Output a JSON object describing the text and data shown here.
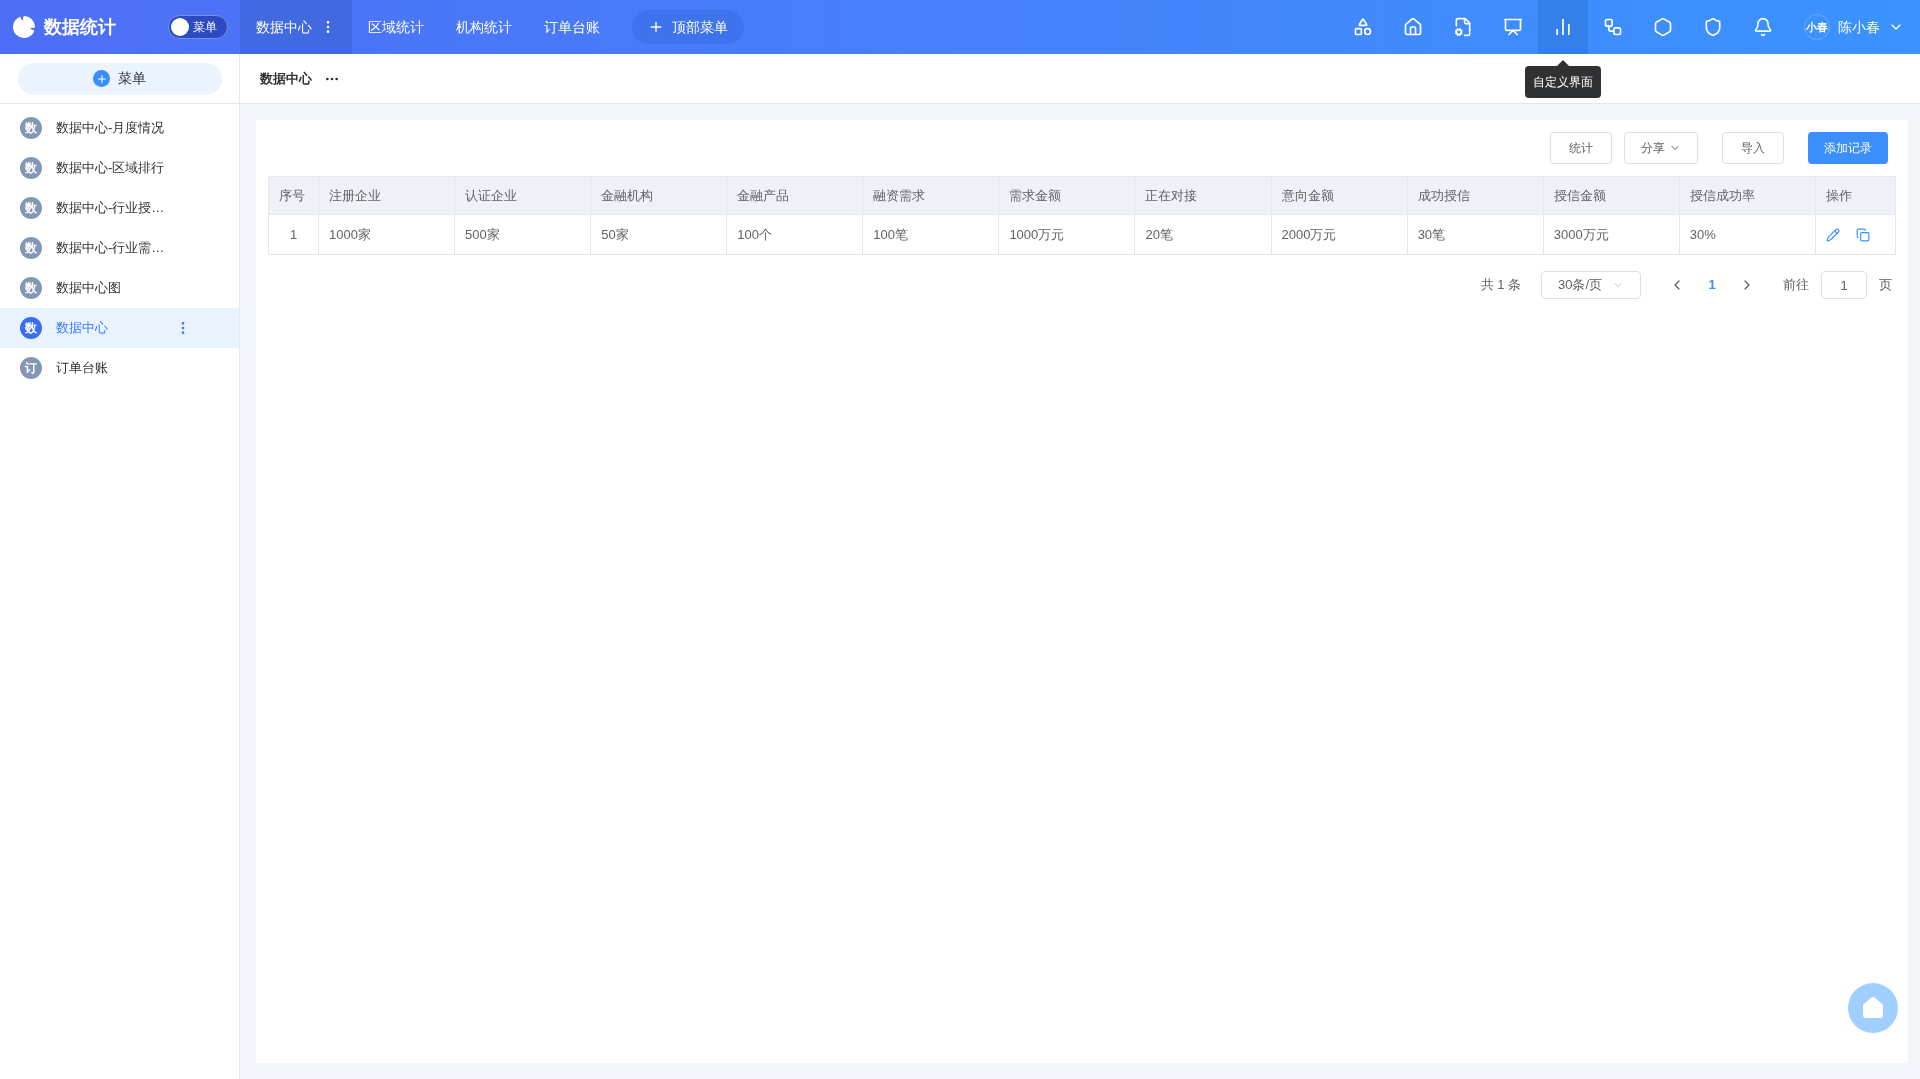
{
  "brand": {
    "title": "数据统计"
  },
  "menu_toggle": {
    "label": "菜单",
    "on": false
  },
  "top_tabs": [
    {
      "label": "数据中心",
      "selected": true,
      "has_more": true
    },
    {
      "label": "区域统计",
      "selected": false,
      "has_more": false
    },
    {
      "label": "机构统计",
      "selected": false,
      "has_more": false
    },
    {
      "label": "订单台账",
      "selected": false,
      "has_more": false
    }
  ],
  "top_menu_button": {
    "label": "顶部菜单"
  },
  "toolbar_icons": [
    {
      "kind": "shapes",
      "selected": false
    },
    {
      "kind": "home",
      "selected": false
    },
    {
      "kind": "file-gear",
      "selected": false
    },
    {
      "kind": "presentation",
      "selected": false
    },
    {
      "kind": "bars",
      "selected": true
    },
    {
      "kind": "workflow",
      "selected": false
    },
    {
      "kind": "hexagon",
      "selected": false
    },
    {
      "kind": "shield",
      "selected": false
    },
    {
      "kind": "bell",
      "selected": false
    }
  ],
  "tooltip": {
    "text": "自定义界面"
  },
  "user": {
    "avatar": "小春",
    "name": "陈小春"
  },
  "sidebar": {
    "add_button": "菜单",
    "items": [
      {
        "badge": "数",
        "label": "数据中心-月度情况",
        "selected": false
      },
      {
        "badge": "数",
        "label": "数据中心-区域排行",
        "selected": false
      },
      {
        "badge": "数",
        "label": "数据中心-行业授…",
        "selected": false
      },
      {
        "badge": "数",
        "label": "数据中心-行业需…",
        "selected": false
      },
      {
        "badge": "数",
        "label": "数据中心图",
        "selected": false
      },
      {
        "badge": "数",
        "label": "数据中心",
        "selected": true
      },
      {
        "badge": "订",
        "label": "订单台账",
        "selected": false
      }
    ]
  },
  "breadcrumb": {
    "title": "数据中心"
  },
  "actions": [
    {
      "label": "统计",
      "kind": "default"
    },
    {
      "label": "分享",
      "kind": "dropdown"
    },
    {
      "label": "导入",
      "kind": "default"
    },
    {
      "label": "添加记录",
      "kind": "primary"
    }
  ],
  "table": {
    "columns": [
      "序号",
      "注册企业",
      "认证企业",
      "金融机构",
      "金融产品",
      "融资需求",
      "需求金额",
      "正在对接",
      "意向金额",
      "成功授信",
      "授信金额",
      "授信成功率",
      "操作"
    ],
    "rows": [
      {
        "cells": [
          "1",
          "1000家",
          "500家",
          "50家",
          "100个",
          "100笔",
          "1000万元",
          "20笔",
          "2000万元",
          "30笔",
          "3000万元",
          "30%"
        ]
      }
    ]
  },
  "pagination": {
    "total": "共 1 条",
    "page_size": "30条/页",
    "pages": [
      {
        "label": "1",
        "selected": true
      }
    ],
    "goto_label": "前往",
    "goto_value": "1",
    "goto_suffix": "页"
  }
}
